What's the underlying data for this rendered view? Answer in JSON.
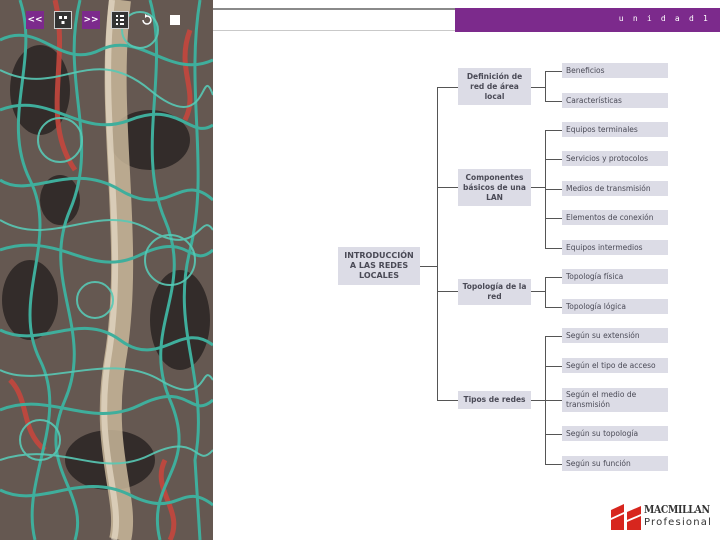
{
  "header": {
    "unit_label": "u n i d a d  1",
    "accent": "#7c2a8c",
    "nav_buttons": [
      {
        "label": "<<",
        "icon": "previous-icon"
      },
      {
        "label": "",
        "icon": "menu-grid-icon"
      },
      {
        "label": ">>",
        "icon": "next-icon"
      },
      {
        "label": "",
        "icon": "index-list-icon"
      },
      {
        "label": "",
        "icon": "return-icon"
      },
      {
        "label": "",
        "icon": "stop-icon"
      }
    ]
  },
  "concept_map": {
    "root": "INTRODUCCIÓN A LAS REDES LOCALES",
    "branches": [
      {
        "label": "Definición de red de área local",
        "leaves": [
          "Beneficios",
          "Características"
        ]
      },
      {
        "label": "Componentes básicos de una LAN",
        "leaves": [
          "Equipos terminales",
          "Servicios y protocolos",
          "Medios de transmisión",
          "Elementos de conexión",
          "Equipos intermedios"
        ]
      },
      {
        "label": "Topología de la red",
        "leaves": [
          "Topología física",
          "Topología lógica"
        ]
      },
      {
        "label": "Tipos de redes",
        "leaves": [
          "Según su extensión",
          "Según el tipo de acceso",
          "Según el medio de transmisión",
          "Según su topología",
          "Según su función"
        ]
      }
    ]
  },
  "logo": {
    "top": "MACMILLAN",
    "bottom": "Profesional"
  }
}
